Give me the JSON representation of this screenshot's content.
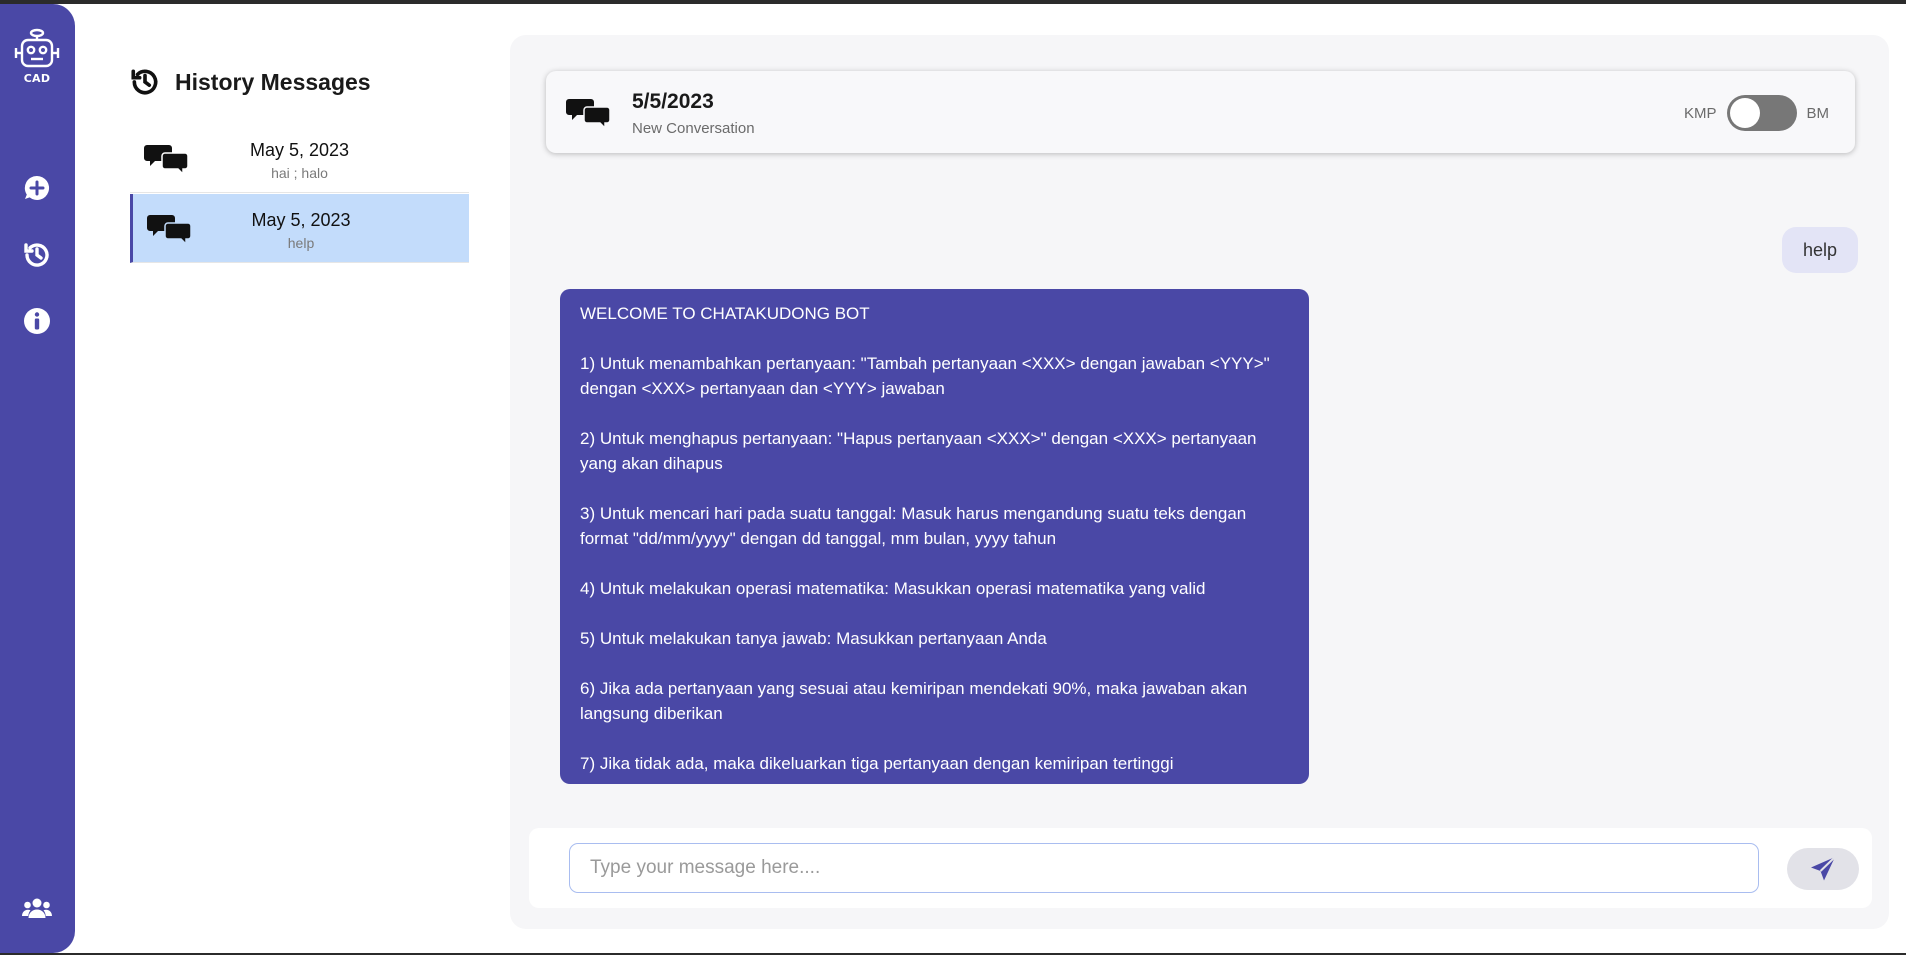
{
  "rail": {
    "logo_text": "CAD",
    "items": [
      {
        "name": "new-chat",
        "icon": "plus-chat-icon"
      },
      {
        "name": "history",
        "icon": "history-icon"
      },
      {
        "name": "info",
        "icon": "info-icon"
      },
      {
        "name": "team",
        "icon": "users-icon"
      }
    ]
  },
  "history": {
    "title": "History Messages",
    "items": [
      {
        "date": "May 5, 2023",
        "preview": "hai ; halo",
        "active": false
      },
      {
        "date": "May 5, 2023",
        "preview": "help",
        "active": true
      }
    ]
  },
  "conversation": {
    "date": "5/5/2023",
    "subtitle": "New Conversation",
    "toggle": {
      "left_label": "KMP",
      "right_label": "BM",
      "state": "KMP"
    }
  },
  "messages": {
    "user": "help",
    "bot": "WELCOME TO CHATAKUDONG BOT\n\n1) Untuk menambahkan pertanyaan: \"Tambah pertanyaan <XXX> dengan jawaban <YYY>\" dengan <XXX> pertanyaan dan <YYY> jawaban\n\n2) Untuk menghapus pertanyaan: \"Hapus pertanyaan <XXX>\" dengan <XXX> pertanyaan yang akan dihapus\n\n3) Untuk mencari hari pada suatu tanggal: Masuk harus mengandung suatu teks dengan format \"dd/mm/yyyy\" dengan dd tanggal, mm bulan, yyyy tahun\n\n4) Untuk melakukan operasi matematika: Masukkan operasi matematika yang valid\n\n5) Untuk melakukan tanya jawab: Masukkan pertanyaan Anda\n\n6) Jika ada pertanyaan yang sesuai atau kemiripan mendekati 90%, maka jawaban akan langsung diberikan\n\n7) Jika tidak ada, maka dikeluarkan tiga pertanyaan dengan kemiripan tertinggi"
  },
  "composer": {
    "placeholder": "Type your message here....",
    "value": "",
    "send_icon": "send-icon"
  },
  "colors": {
    "accent": "#4a48a6",
    "active_item": "#c3dcfb",
    "panel": "#f6f6f8"
  }
}
